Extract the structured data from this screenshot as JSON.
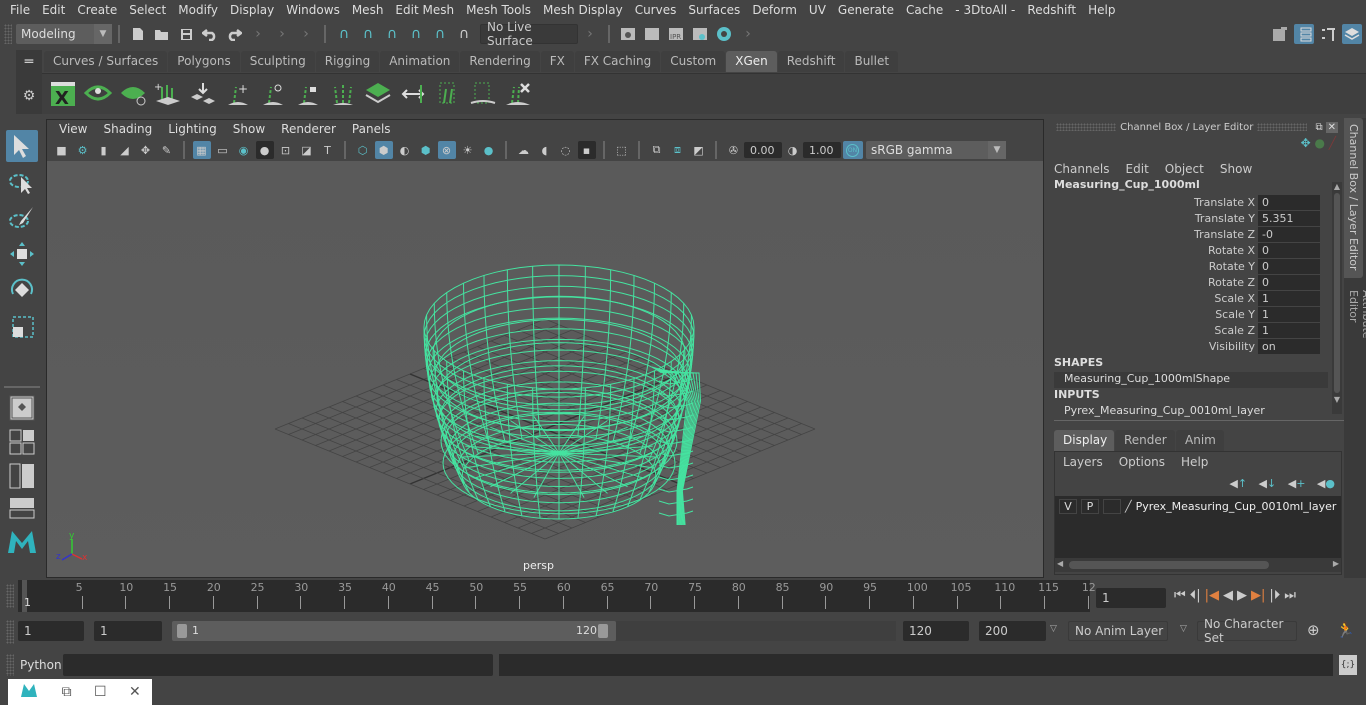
{
  "menubar": [
    "File",
    "Edit",
    "Create",
    "Select",
    "Modify",
    "Display",
    "Windows",
    "Mesh",
    "Edit Mesh",
    "Mesh Tools",
    "Mesh Display",
    "Curves",
    "Surfaces",
    "Deform",
    "UV",
    "Generate",
    "Cache",
    "- 3DtoAll -",
    "Redshift",
    "Help"
  ],
  "statusline": {
    "mode": "Modeling",
    "live_surface": "No Live Surface",
    "icons": [
      "new-scene-icon",
      "open-scene-icon",
      "save-scene-icon",
      "undo-icon",
      "redo-icon"
    ],
    "snap_icons": [
      "snap-grid-icon",
      "snap-curve-icon",
      "snap-point-icon",
      "snap-view-plane-icon",
      "snap-live-icon",
      "make-live-icon"
    ],
    "render_icons": [
      "render-view-icon",
      "render-frame-icon",
      "ipr-render-icon",
      "render-settings-icon",
      "hypershade-icon"
    ],
    "right_icons": [
      "modeling-toolkit-icon",
      "attribute-editor-toggle-icon",
      "tool-settings-icon",
      "channel-box-toggle-icon"
    ]
  },
  "shelf": {
    "tabs": [
      "Curves / Surfaces",
      "Polygons",
      "Sculpting",
      "Rigging",
      "Animation",
      "Rendering",
      "FX",
      "FX Caching",
      "Custom",
      "XGen",
      "Redshift",
      "Bullet"
    ],
    "active_tab": "XGen",
    "tools": [
      "xgen-editor-icon",
      "toggle-visibility-icon",
      "hide-description-icon",
      "create-description-icon",
      "place-guides-icon",
      "add-guide-icon",
      "select-guide-icon",
      "lock-guide-icon",
      "guides-to-curves-icon",
      "create-patches-icon",
      "transfer-guides-icon",
      "export-guides-icon",
      "preview-guides-icon",
      "delete-guides-icon"
    ]
  },
  "toolbox": [
    "select-tool-icon",
    "lasso-tool-icon",
    "paint-select-icon",
    "move-tool-icon",
    "rotate-tool-icon",
    "scale-tool-icon",
    "single-pane-layout-icon",
    "four-pane-layout-icon",
    "outliner-layout-icon",
    "graph-layout-icon",
    "maya-logo-icon"
  ],
  "viewport": {
    "menu": [
      "View",
      "Shading",
      "Lighting",
      "Show",
      "Renderer",
      "Panels"
    ],
    "exposure": "0.00",
    "gamma": "1.00",
    "color_mgmt_badge": "ON",
    "color_space": "sRGB gamma",
    "camera_label": "persp",
    "axis_labels": {
      "x": "x",
      "y": "y",
      "z": "z"
    },
    "wire_color": "#45e3a0"
  },
  "channel_box": {
    "title": "Channel Box / Layer Editor",
    "menu": [
      "Channels",
      "Edit",
      "Object",
      "Show"
    ],
    "object_name": "Measuring_Cup_1000ml",
    "channels": [
      {
        "label": "Translate X",
        "value": "0"
      },
      {
        "label": "Translate Y",
        "value": "5.351"
      },
      {
        "label": "Translate Z",
        "value": "-0"
      },
      {
        "label": "Rotate X",
        "value": "0"
      },
      {
        "label": "Rotate Y",
        "value": "0"
      },
      {
        "label": "Rotate Z",
        "value": "0"
      },
      {
        "label": "Scale X",
        "value": "1"
      },
      {
        "label": "Scale Y",
        "value": "1"
      },
      {
        "label": "Scale Z",
        "value": "1"
      },
      {
        "label": "Visibility",
        "value": "on"
      }
    ],
    "shapes_header": "SHAPES",
    "shape_name": "Measuring_Cup_1000mlShape",
    "inputs_header": "INPUTS",
    "input_name": "Pyrex_Measuring_Cup_0010ml_layer"
  },
  "layer_editor": {
    "tabs": [
      "Display",
      "Render",
      "Anim"
    ],
    "active_tab": "Display",
    "menu": [
      "Layers",
      "Options",
      "Help"
    ],
    "layer": {
      "v": "V",
      "p": "P",
      "name": "Pyrex_Measuring_Cup_0010ml_layer"
    }
  },
  "side_tabs": [
    "Channel Box / Layer Editor",
    "Attribute Editor"
  ],
  "timeline": {
    "ticks": [
      "5",
      "10",
      "15",
      "20",
      "25",
      "30",
      "35",
      "40",
      "45",
      "50",
      "55",
      "60",
      "65",
      "70",
      "75",
      "80",
      "85",
      "90",
      "95",
      "100",
      "105",
      "110",
      "115",
      "12"
    ],
    "current_marker": "1",
    "current_frame": "1"
  },
  "range": {
    "start": "1",
    "playback_start": "1",
    "slider_start": "1",
    "slider_end": "120",
    "playback_end": "120",
    "end": "200",
    "anim_layer": "No Anim Layer",
    "character_set": "No Character Set"
  },
  "cmdline": {
    "label": "Python"
  }
}
